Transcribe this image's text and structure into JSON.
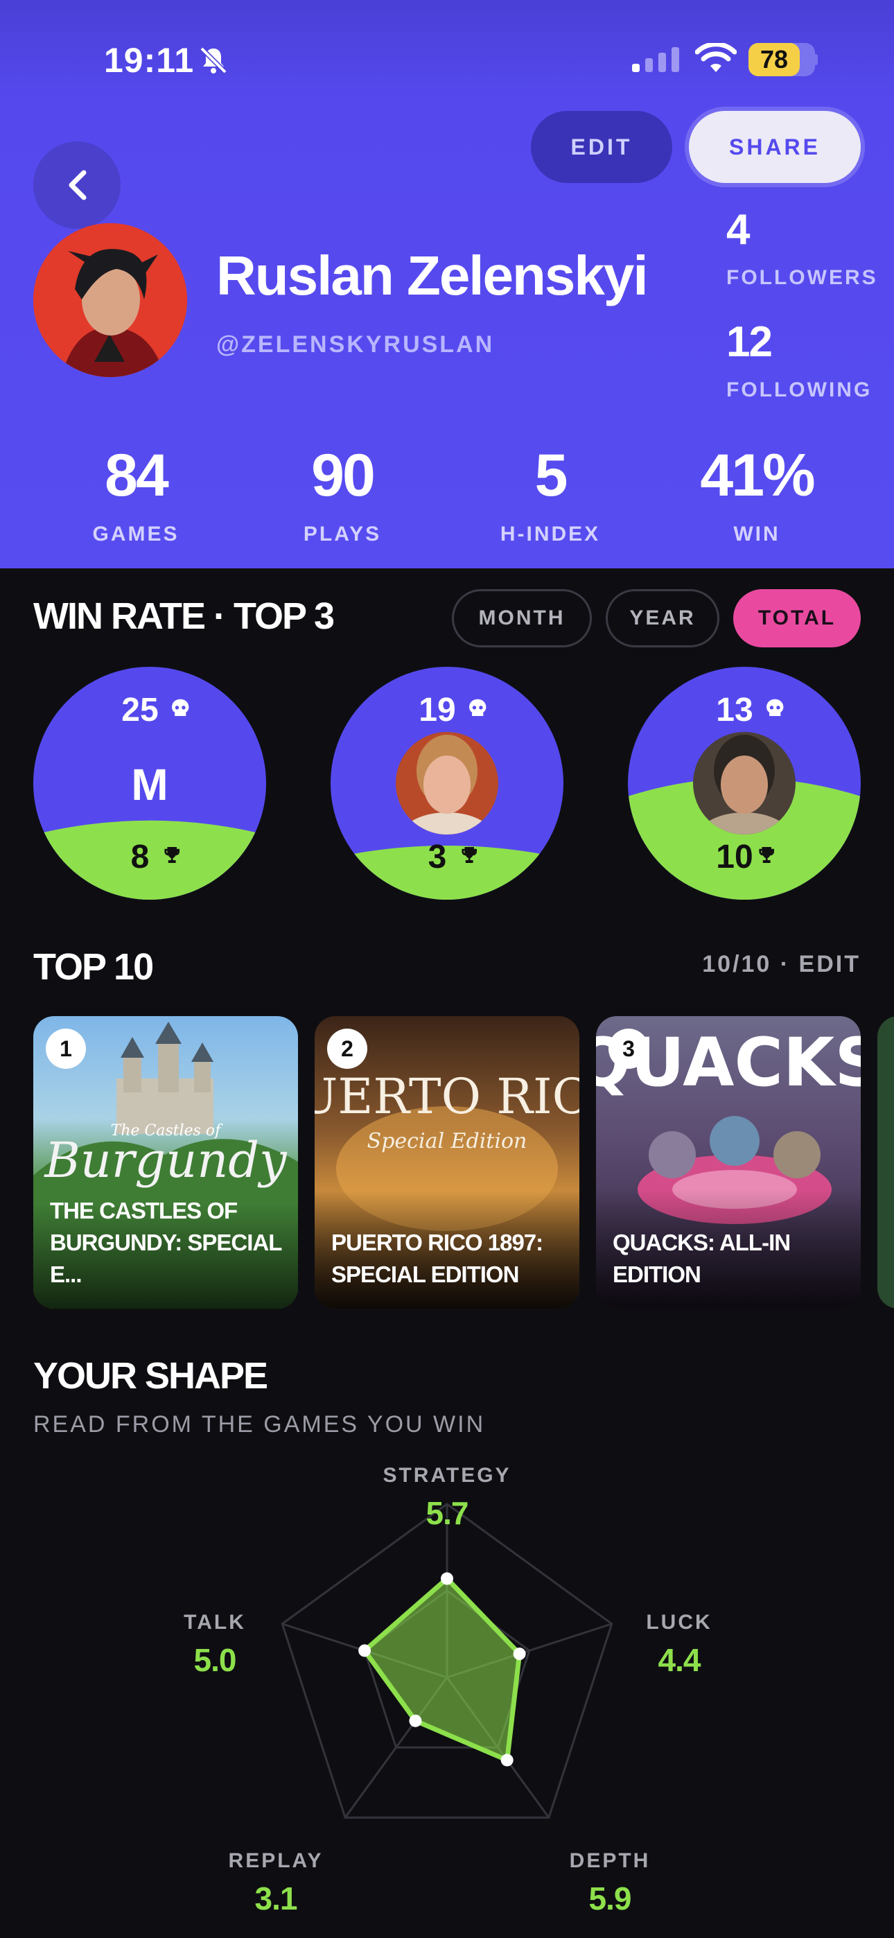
{
  "status_bar": {
    "time": "19:11",
    "battery": "78"
  },
  "header": {
    "edit_label": "EDIT",
    "share_label": "SHARE"
  },
  "profile": {
    "name": "Ruslan Zelenskyi",
    "handle": "@ZELENSKYRUSLAN",
    "followers_count": "4",
    "followers_label": "FOLLOWERS",
    "following_count": "12",
    "following_label": "FOLLOWING"
  },
  "stats": [
    {
      "value": "84",
      "label": "GAMES"
    },
    {
      "value": "90",
      "label": "PLAYS"
    },
    {
      "value": "5",
      "label": "H-INDEX"
    },
    {
      "value": "41%",
      "label": "WIN"
    }
  ],
  "win_rate": {
    "title": "WIN RATE · TOP 3",
    "filters": [
      "MONTH",
      "YEAR",
      "TOTAL"
    ],
    "active_filter": "TOTAL",
    "opponents": [
      {
        "initial": "M",
        "losses": "25",
        "wins": "8",
        "win_fraction": 0.24
      },
      {
        "initial": "",
        "losses": "19",
        "wins": "3",
        "win_fraction": 0.14
      },
      {
        "initial": "",
        "losses": "13",
        "wins": "10",
        "win_fraction": 0.43
      }
    ]
  },
  "top10": {
    "title": "TOP 10",
    "meta": "10/10 · EDIT",
    "games": [
      {
        "rank": "1",
        "title": "THE CASTLES OF BURGUNDY: SPECIAL E...",
        "art_text": "Burgundy",
        "art_small": "The Castles of"
      },
      {
        "rank": "2",
        "title": "PUERTO RICO 1897: SPECIAL EDITION",
        "art_text": "PUERTO RICO",
        "art_small": "Special Edition"
      },
      {
        "rank": "3",
        "title": "QUACKS: ALL-IN EDITION",
        "art_text": "QUACKS",
        "art_small": ""
      }
    ]
  },
  "shape": {
    "title": "YOUR SHAPE",
    "subtitle": "READ FROM THE GAMES YOU WIN",
    "axes": [
      {
        "label": "STRATEGY",
        "value": "5.7"
      },
      {
        "label": "LUCK",
        "value": "4.4"
      },
      {
        "label": "DEPTH",
        "value": "5.9"
      },
      {
        "label": "REPLAY",
        "value": "3.1"
      },
      {
        "label": "TALK",
        "value": "5.0"
      }
    ],
    "max": 10
  },
  "colors": {
    "accent": "#5549ee",
    "win_green": "#8de04b",
    "pill_active": "#e94aa0",
    "background": "#0e0e12"
  }
}
